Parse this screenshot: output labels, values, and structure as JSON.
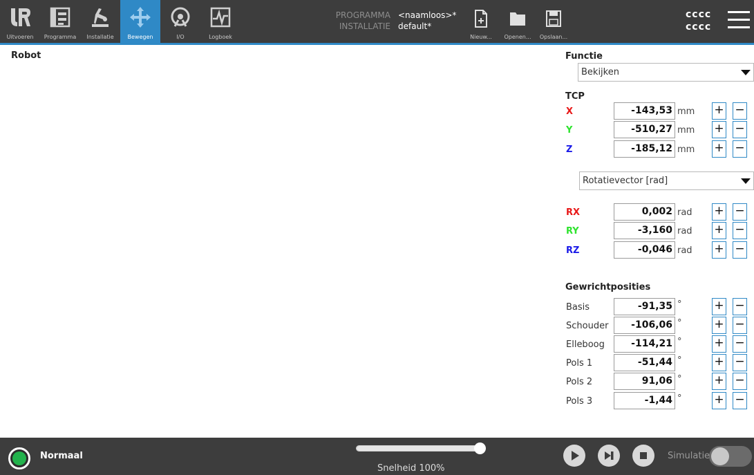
{
  "colors": {
    "topbar": "#3d3d3d",
    "accent": "#2f89c6",
    "x_axis": "#e81818",
    "y_axis": "#2ee32e",
    "z_axis": "#1a1ae8",
    "status_ok": "#22b24c"
  },
  "nav": {
    "items": [
      {
        "label": "Uitvoeren",
        "icon": "ur-logo-icon"
      },
      {
        "label": "Programma",
        "icon": "program-icon"
      },
      {
        "label": "Installatie",
        "icon": "robot-arm-icon"
      },
      {
        "label": "Bewegen",
        "icon": "move-arrows-icon",
        "active": true
      },
      {
        "label": "I/O",
        "icon": "io-icon"
      },
      {
        "label": "Logboek",
        "icon": "log-icon"
      }
    ]
  },
  "program": {
    "program_key": "PROGRAMMA",
    "program_value": "<naamloos>*",
    "installation_key": "INSTALLATIE",
    "installation_value": "default*"
  },
  "file": {
    "new_label": "Nieuw...",
    "open_label": "Openen...",
    "save_label": "Opslaan..."
  },
  "user": {
    "line1": "cccc",
    "line2": "cccc"
  },
  "main": {
    "title": "Robot"
  },
  "functie": {
    "title": "Functie",
    "selected": "Bekijken"
  },
  "tcp": {
    "title": "TCP",
    "rows": [
      {
        "label": "X",
        "value": "-143,53",
        "unit": "mm"
      },
      {
        "label": "Y",
        "value": "-510,27",
        "unit": "mm"
      },
      {
        "label": "Z",
        "value": "-185,12",
        "unit": "mm"
      }
    ],
    "rotation_mode": "Rotatievector [rad]",
    "rot_rows": [
      {
        "label": "RX",
        "value": "0,002",
        "unit": "rad"
      },
      {
        "label": "RY",
        "value": "-3,160",
        "unit": "rad"
      },
      {
        "label": "RZ",
        "value": "-0,046",
        "unit": "rad"
      }
    ]
  },
  "joints": {
    "title": "Gewrichtposities",
    "rows": [
      {
        "label": "Basis",
        "value": "-91,35",
        "unit": "°"
      },
      {
        "label": "Schouder",
        "value": "-106,06",
        "unit": "°"
      },
      {
        "label": "Elleboog",
        "value": "-114,21",
        "unit": "°"
      },
      {
        "label": "Pols 1",
        "value": "-51,44",
        "unit": "°"
      },
      {
        "label": "Pols 2",
        "value": "91,06",
        "unit": "°"
      },
      {
        "label": "Pols 3",
        "value": "-1,44",
        "unit": "°"
      }
    ]
  },
  "buttons": {
    "plus": "+",
    "minus": "−"
  },
  "footer": {
    "status": "Normaal",
    "speed_text": "Snelheid 100%",
    "speed_percent": 100,
    "simulation_label": "Simulatie",
    "simulation_on": false
  }
}
